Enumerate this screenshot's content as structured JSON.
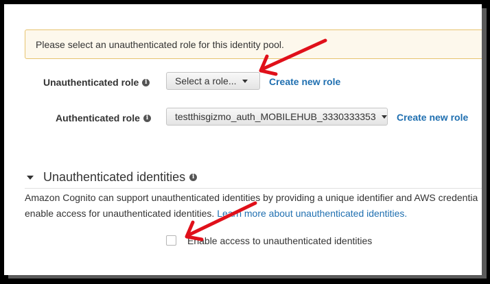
{
  "alert": {
    "message": "Please select an unauthenticated role for this identity pool."
  },
  "roles": {
    "unauthenticated": {
      "label": "Unauthenticated role",
      "selected": "Select a role...",
      "create_link": "Create new role"
    },
    "authenticated": {
      "label": "Authenticated role",
      "selected": "testthisgizmo_auth_MOBILEHUB_3330333353",
      "create_link": "Create new role"
    }
  },
  "unauth_section": {
    "title": "Unauthenticated identities",
    "description_line1": "Amazon Cognito can support unauthenticated identities by providing a unique identifier and AWS credentia",
    "description_line2_prefix": "enable access for unauthenticated identities.",
    "learn_more_link": "Learn more about unauthenticated identities.",
    "checkbox_label": "Enable access to unauthenticated identities",
    "checkbox_checked": false
  },
  "colors": {
    "link": "#1f6fb0",
    "alert_border": "#e6c36e",
    "alert_bg": "#fdf8ec",
    "annotation_arrow": "#e0101a"
  },
  "icons": {
    "info": "info-icon",
    "caret": "caret-down-icon",
    "collapse": "triangle-down-icon",
    "annotation": "red-arrow-icon"
  }
}
